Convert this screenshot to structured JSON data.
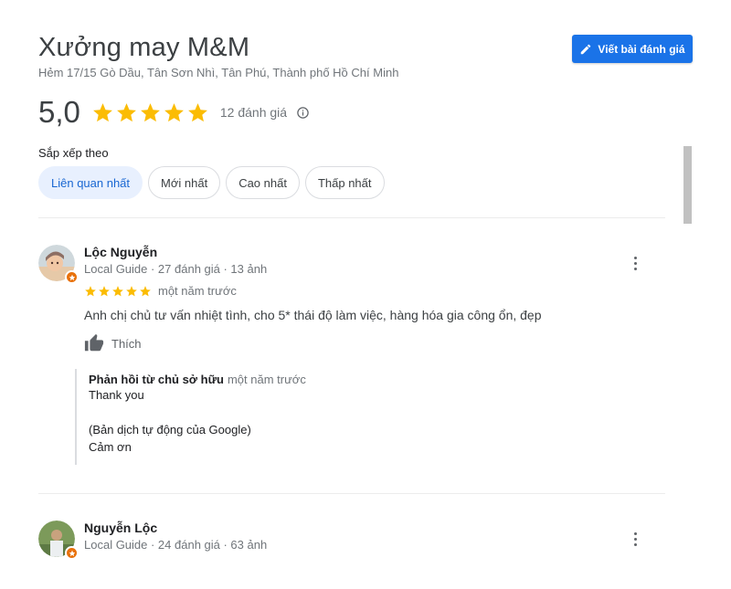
{
  "place": {
    "title": "Xưởng may M&M",
    "address": "Hẻm 17/15 Gò Dầu, Tân Sơn Nhì, Tân Phú, Thành phố Hồ Chí Minh"
  },
  "write_review_label": "Viết bài đánh giá",
  "rating": {
    "score": "5,0",
    "stars": 5,
    "count_label": "12 đánh giá",
    "star_color": "#fbbc04"
  },
  "sort": {
    "label": "Sắp xếp theo",
    "options": [
      "Liên quan nhất",
      "Mới nhất",
      "Cao nhất",
      "Thấp nhất"
    ],
    "selected": "Liên quan nhất"
  },
  "reviews": [
    {
      "name": "Lộc Nguyễn",
      "meta": "Local Guide · 27 đánh giá · 13 ảnh",
      "stars": 5,
      "time": "một năm trước",
      "text": "Anh chị chủ tư vấn nhiệt tình, cho 5* thái độ làm việc, hàng hóa gia công ổn, đẹp",
      "like_label": "Thích",
      "owner_reply": {
        "heading": "Phản hồi từ chủ sở hữu",
        "time": "một năm trước",
        "text": "Thank you",
        "translation_note": "(Bản dịch tự động của Google)",
        "translation": "Cảm ơn"
      }
    },
    {
      "name": "Nguyễn Lộc",
      "meta": "Local Guide · 24 đánh giá · 63 ảnh"
    }
  ],
  "colors": {
    "accent": "#1a73e8",
    "badge": "#e8710a",
    "chip_active_bg": "#e8f0fe"
  }
}
